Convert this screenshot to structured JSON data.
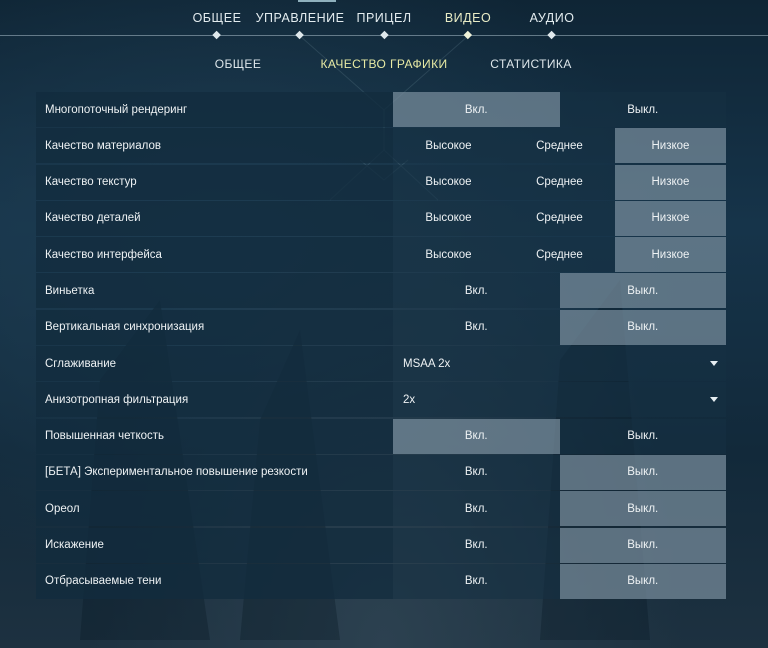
{
  "top_tabs": [
    {
      "label": "ОБЩЕЕ",
      "active": false
    },
    {
      "label": "УПРАВЛЕНИЕ",
      "active": false
    },
    {
      "label": "ПРИЦЕЛ",
      "active": false
    },
    {
      "label": "ВИДЕО",
      "active": true
    },
    {
      "label": "АУДИО",
      "active": false
    }
  ],
  "sub_tabs": [
    {
      "label": "ОБЩЕЕ",
      "active": false
    },
    {
      "label": "КАЧЕСТВО ГРАФИКИ",
      "active": true
    },
    {
      "label": "СТАТИСТИКА",
      "active": false
    }
  ],
  "colors": {
    "accent_active": "#e8eaa4",
    "selected_option": "#7a8e9c"
  },
  "settings": [
    {
      "label": "Многопоточный рендеринг",
      "options": [
        "Вкл.",
        "Выкл."
      ],
      "selected": 0
    },
    {
      "label": "Качество материалов",
      "options": [
        "Высокое",
        "Среднее",
        "Низкое"
      ],
      "selected": 2
    },
    {
      "label": "Качество текстур",
      "options": [
        "Высокое",
        "Среднее",
        "Низкое"
      ],
      "selected": 2
    },
    {
      "label": "Качество деталей",
      "options": [
        "Высокое",
        "Среднее",
        "Низкое"
      ],
      "selected": 2
    },
    {
      "label": "Качество интерфейса",
      "options": [
        "Высокое",
        "Среднее",
        "Низкое"
      ],
      "selected": 2
    },
    {
      "label": "Виньетка",
      "options": [
        "Вкл.",
        "Выкл."
      ],
      "selected": 1
    },
    {
      "label": "Вертикальная синхронизация",
      "options": [
        "Вкл.",
        "Выкл."
      ],
      "selected": 1
    },
    {
      "label": "Сглаживание",
      "dropdown": "MSAA 2x"
    },
    {
      "label": "Анизотропная фильтрация",
      "dropdown": "2x"
    },
    {
      "label": "Повышенная четкость",
      "options": [
        "Вкл.",
        "Выкл."
      ],
      "selected": 0
    },
    {
      "label": "[БЕТА] Экспериментальное повышение резкости",
      "options": [
        "Вкл.",
        "Выкл."
      ],
      "selected": 1
    },
    {
      "label": "Ореол",
      "options": [
        "Вкл.",
        "Выкл."
      ],
      "selected": 1
    },
    {
      "label": "Искажение",
      "options": [
        "Вкл.",
        "Выкл."
      ],
      "selected": 1
    },
    {
      "label": "Отбрасываемые тени",
      "options": [
        "Вкл.",
        "Выкл."
      ],
      "selected": 1
    }
  ]
}
